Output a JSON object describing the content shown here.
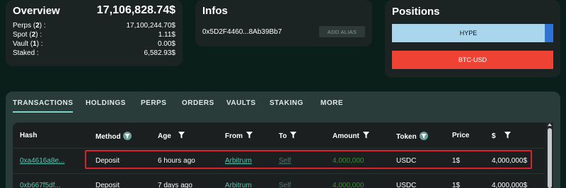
{
  "overview": {
    "title": "Overview",
    "total": "17,106,828.74$",
    "rows": [
      {
        "label_pre": "Perps (",
        "count": "2",
        "label_post": ") :",
        "value": "17,100,244.70$"
      },
      {
        "label_pre": "Spot (",
        "count": "2",
        "label_post": ") :",
        "value": "1.11$"
      },
      {
        "label_pre": "Vault (",
        "count": "1",
        "label_post": ") :",
        "value": "0.00$"
      },
      {
        "label_pre": "Staked :",
        "count": "",
        "label_post": "",
        "value": "6,582.93$"
      }
    ]
  },
  "infos": {
    "title": "Infos",
    "address": "0x5D2F4460...8Ab39Bb7",
    "add_alias_label": "ADD ALIAS"
  },
  "positions": {
    "title": "Positions",
    "items": [
      {
        "label": "HYPE",
        "color": "#a9d6ec",
        "accent": "#2f73d4"
      },
      {
        "label": "BTC-USD",
        "color": "#ee4234"
      }
    ]
  },
  "tabs": [
    "TRANSACTIONS",
    "HOLDINGS",
    "PERPS",
    "ORDERS",
    "VAULTS",
    "STAKING",
    "MORE"
  ],
  "active_tab": "TRANSACTIONS",
  "table": {
    "columns": [
      "Hash",
      "Method",
      "Age",
      "From",
      "To",
      "Amount",
      "Token",
      "Price",
      "$"
    ],
    "rows": [
      {
        "hash": "0xa4616a8e...",
        "method": "Deposit",
        "age": "6 hours ago",
        "from": "Arbitrum",
        "to": "Self",
        "amount": "4,000,000",
        "token": "USDC",
        "price": "1$",
        "usd": "4,000,000$"
      },
      {
        "hash": "0xb667f5df...",
        "method": "Deposit",
        "age": "7 days ago",
        "from": "Arbitrum",
        "to": "Self",
        "amount": "4,000,000",
        "token": "USDC",
        "price": "1$",
        "usd": "4,000,000$"
      }
    ]
  },
  "colors": {
    "background": "#0a1f1a",
    "card": "#1c2423",
    "link": "#5ec4b4",
    "amount_green": "#3f8a3a",
    "highlight_red": "#e0202c"
  }
}
